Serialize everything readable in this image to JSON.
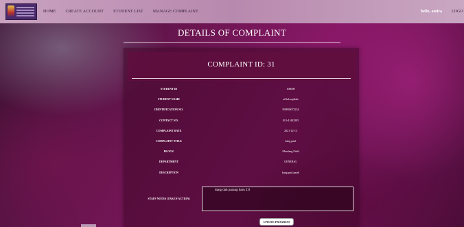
{
  "nav": {
    "items": [
      {
        "label": "HOME"
      },
      {
        "label": "CREATE ACCOUNT"
      },
      {
        "label": "STUDENT LIST"
      },
      {
        "label": "MANAGE COMPLAINT"
      }
    ],
    "hello": "hello, amira",
    "logout": "LOGO"
  },
  "page": {
    "title": "DETAILS OF COMPLAINT"
  },
  "complaint": {
    "heading": "COMPLAINT ID: 31",
    "fields": [
      {
        "label": "STUDENT ID",
        "value": "100000"
      },
      {
        "label": "STUDENT NAME",
        "value": "afifah najibah"
      },
      {
        "label": "IDENTIFICATION NO.",
        "value": "990830073234"
      },
      {
        "label": "CONTACT NO.",
        "value": "013-41442305"
      },
      {
        "label": "COMPLAINT DATE",
        "value": "2021-12-13"
      },
      {
        "label": "COMPLAINT TITLE",
        "value": "kang paul"
      },
      {
        "label": "BLOCK",
        "value": "Mawlang Field"
      },
      {
        "label": "DEPARTMENT",
        "value": "GENERAL"
      },
      {
        "label": "DESCRIPTION",
        "value": "kang paul patah"
      }
    ],
    "notes_label": "STAFF NOTES (TAKEN ACTION)",
    "notes_value": "tiang dah pasang baru 2.0",
    "update_button": "UPDATE PROGRESS"
  }
}
